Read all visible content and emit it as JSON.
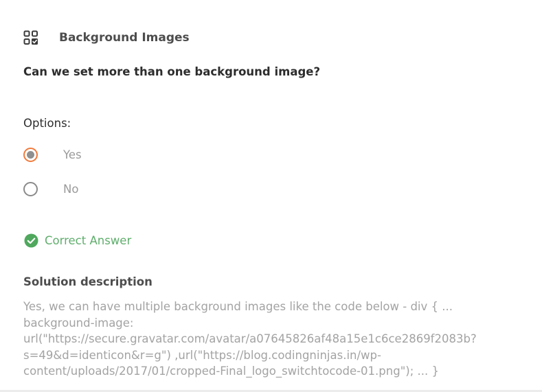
{
  "header": {
    "icon": "apps-grid-check-icon",
    "title": "Background Images"
  },
  "question": "Can we set more than one background image?",
  "options": {
    "label": "Options:",
    "items": [
      {
        "label": "Yes",
        "selected": true
      },
      {
        "label": "No",
        "selected": false
      }
    ]
  },
  "result": {
    "icon": "check-circle-icon",
    "text": "Correct Answer"
  },
  "solution": {
    "title": "Solution description",
    "text": "Yes, we can have multiple background images like the code below - div { ... background-image: url(\"https://secure.gravatar.com/avatar/a07645826af48a15e1c6ce2869f2083b?s=49&d=identicon&r=g\") ,url(\"https://blog.codingninjas.in/wp-content/uploads/2017/01/cropped-Final_logo_switchtocode-01.png\"); ... }"
  },
  "colors": {
    "radio_selected_border": "#f07a3b",
    "correct_green": "#5fae6c",
    "muted_text": "#a3a3a3"
  }
}
